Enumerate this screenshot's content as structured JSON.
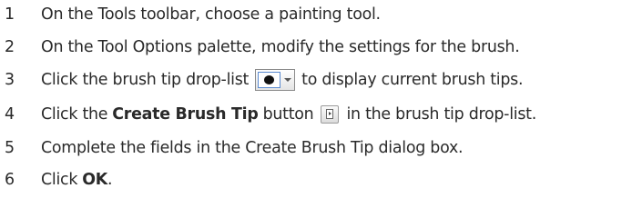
{
  "steps": [
    {
      "num": "1",
      "text": "On the Tools toolbar, choose a painting tool."
    },
    {
      "num": "2",
      "text": "On the Tool Options palette, modify the settings for the brush."
    },
    {
      "num": "3",
      "before": "Click the brush tip drop-list",
      "after": "to display current brush tips."
    },
    {
      "num": "4",
      "before": "Click the",
      "bold": "Create Brush Tip",
      "middle": "button",
      "after": "in the brush tip drop-list."
    },
    {
      "num": "5",
      "text": "Complete the fields in the Create Brush Tip dialog box."
    },
    {
      "num": "6",
      "before": "Click",
      "bold": "OK",
      "after": "."
    }
  ],
  "icons": {
    "brush_tip_droplist": "brush-tip-droplist-icon",
    "create_brush_tip": "create-brush-tip-icon"
  }
}
